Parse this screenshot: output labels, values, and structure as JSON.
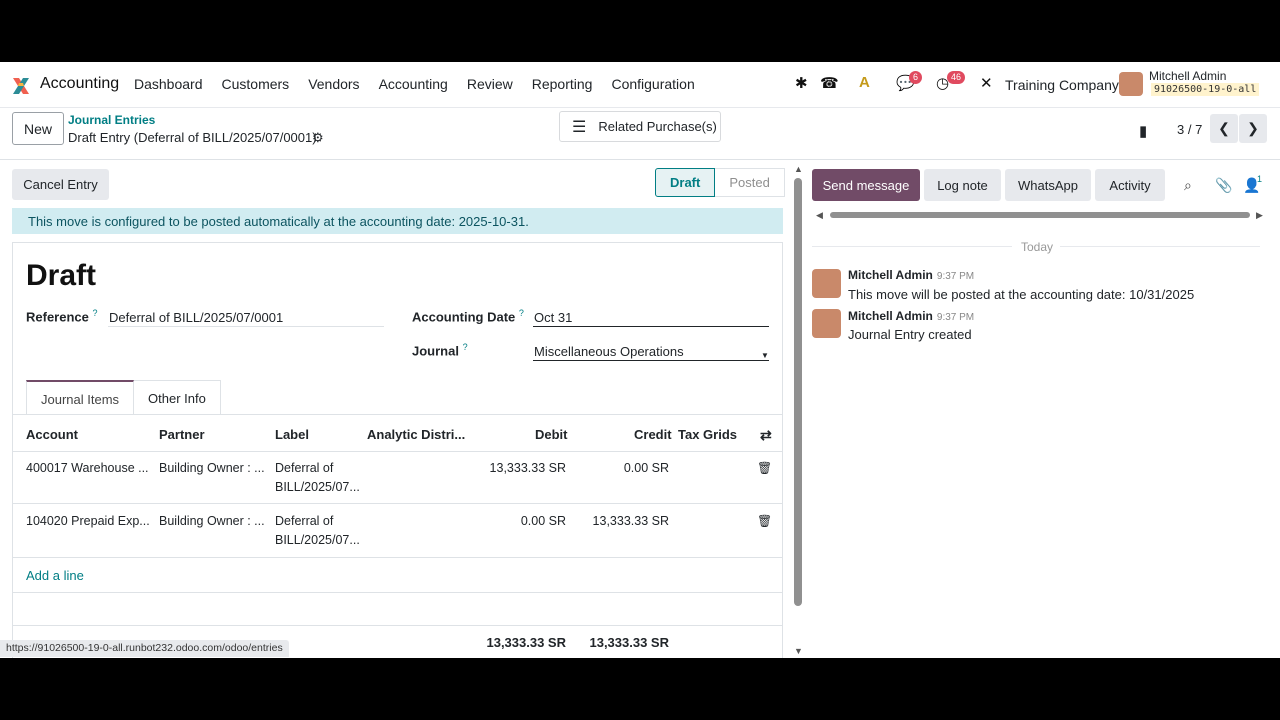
{
  "app": {
    "name": "Accounting"
  },
  "menu": [
    "Dashboard",
    "Customers",
    "Vendors",
    "Accounting",
    "Review",
    "Reporting",
    "Configuration"
  ],
  "systray": {
    "chat_count": "6",
    "activity_count": "46",
    "company": "Training Company",
    "user_name": "Mitchell Admin",
    "database": "91026500-19-0-all"
  },
  "control": {
    "new_label": "New",
    "breadcrumb_parent": "Journal Entries",
    "breadcrumb_current": "Draft Entry (Deferral of BILL/2025/07/0001)",
    "related_label": "Related Purchase(s)",
    "pager": "3 / 7"
  },
  "form": {
    "cancel_label": "Cancel Entry",
    "status_draft": "Draft",
    "status_posted": "Posted",
    "alert": "This move is configured to be posted automatically at the accounting date: 2025-10-31.",
    "title": "Draft",
    "reference_label": "Reference",
    "reference_value": "Deferral of BILL/2025/07/0001",
    "acc_date_label": "Accounting Date",
    "acc_date_value": "Oct 31",
    "journal_label": "Journal",
    "journal_value": "Miscellaneous Operations",
    "help_mark": "?",
    "tabs": [
      "Journal Items",
      "Other Info"
    ],
    "columns": [
      "Account",
      "Partner",
      "Label",
      "Analytic Distri...",
      "Debit",
      "Credit",
      "Tax Grids"
    ],
    "lines": [
      {
        "account": "400017 Warehouse ...",
        "partner": "Building Owner : ...",
        "label1": "Deferral of",
        "label2": "BILL/2025/07...",
        "debit": "13,333.33 SR",
        "credit": "0.00 SR"
      },
      {
        "account": "104020 Prepaid Exp...",
        "partner": "Building Owner : ...",
        "label1": "Deferral of",
        "label2": "BILL/2025/07...",
        "debit": "0.00 SR",
        "credit": "13,333.33 SR"
      }
    ],
    "add_line": "Add a line",
    "total_debit": "13,333.33 SR",
    "total_credit": "13,333.33 SR"
  },
  "status_url": "https://91026500-19-0-all.runbot232.odoo.com/odoo/entries",
  "chatter": {
    "send_message": "Send message",
    "log_note": "Log note",
    "whatsapp": "WhatsApp",
    "activity": "Activity",
    "followers_count": "1",
    "today": "Today",
    "messages": [
      {
        "author": "Mitchell Admin",
        "time": "9:37 PM",
        "body": "This move will be posted at the accounting date: 10/31/2025"
      },
      {
        "author": "Mitchell Admin",
        "time": "9:37 PM",
        "body": "Journal Entry created"
      }
    ]
  },
  "colors": {
    "brand": "#714b67",
    "link": "#017e84"
  }
}
